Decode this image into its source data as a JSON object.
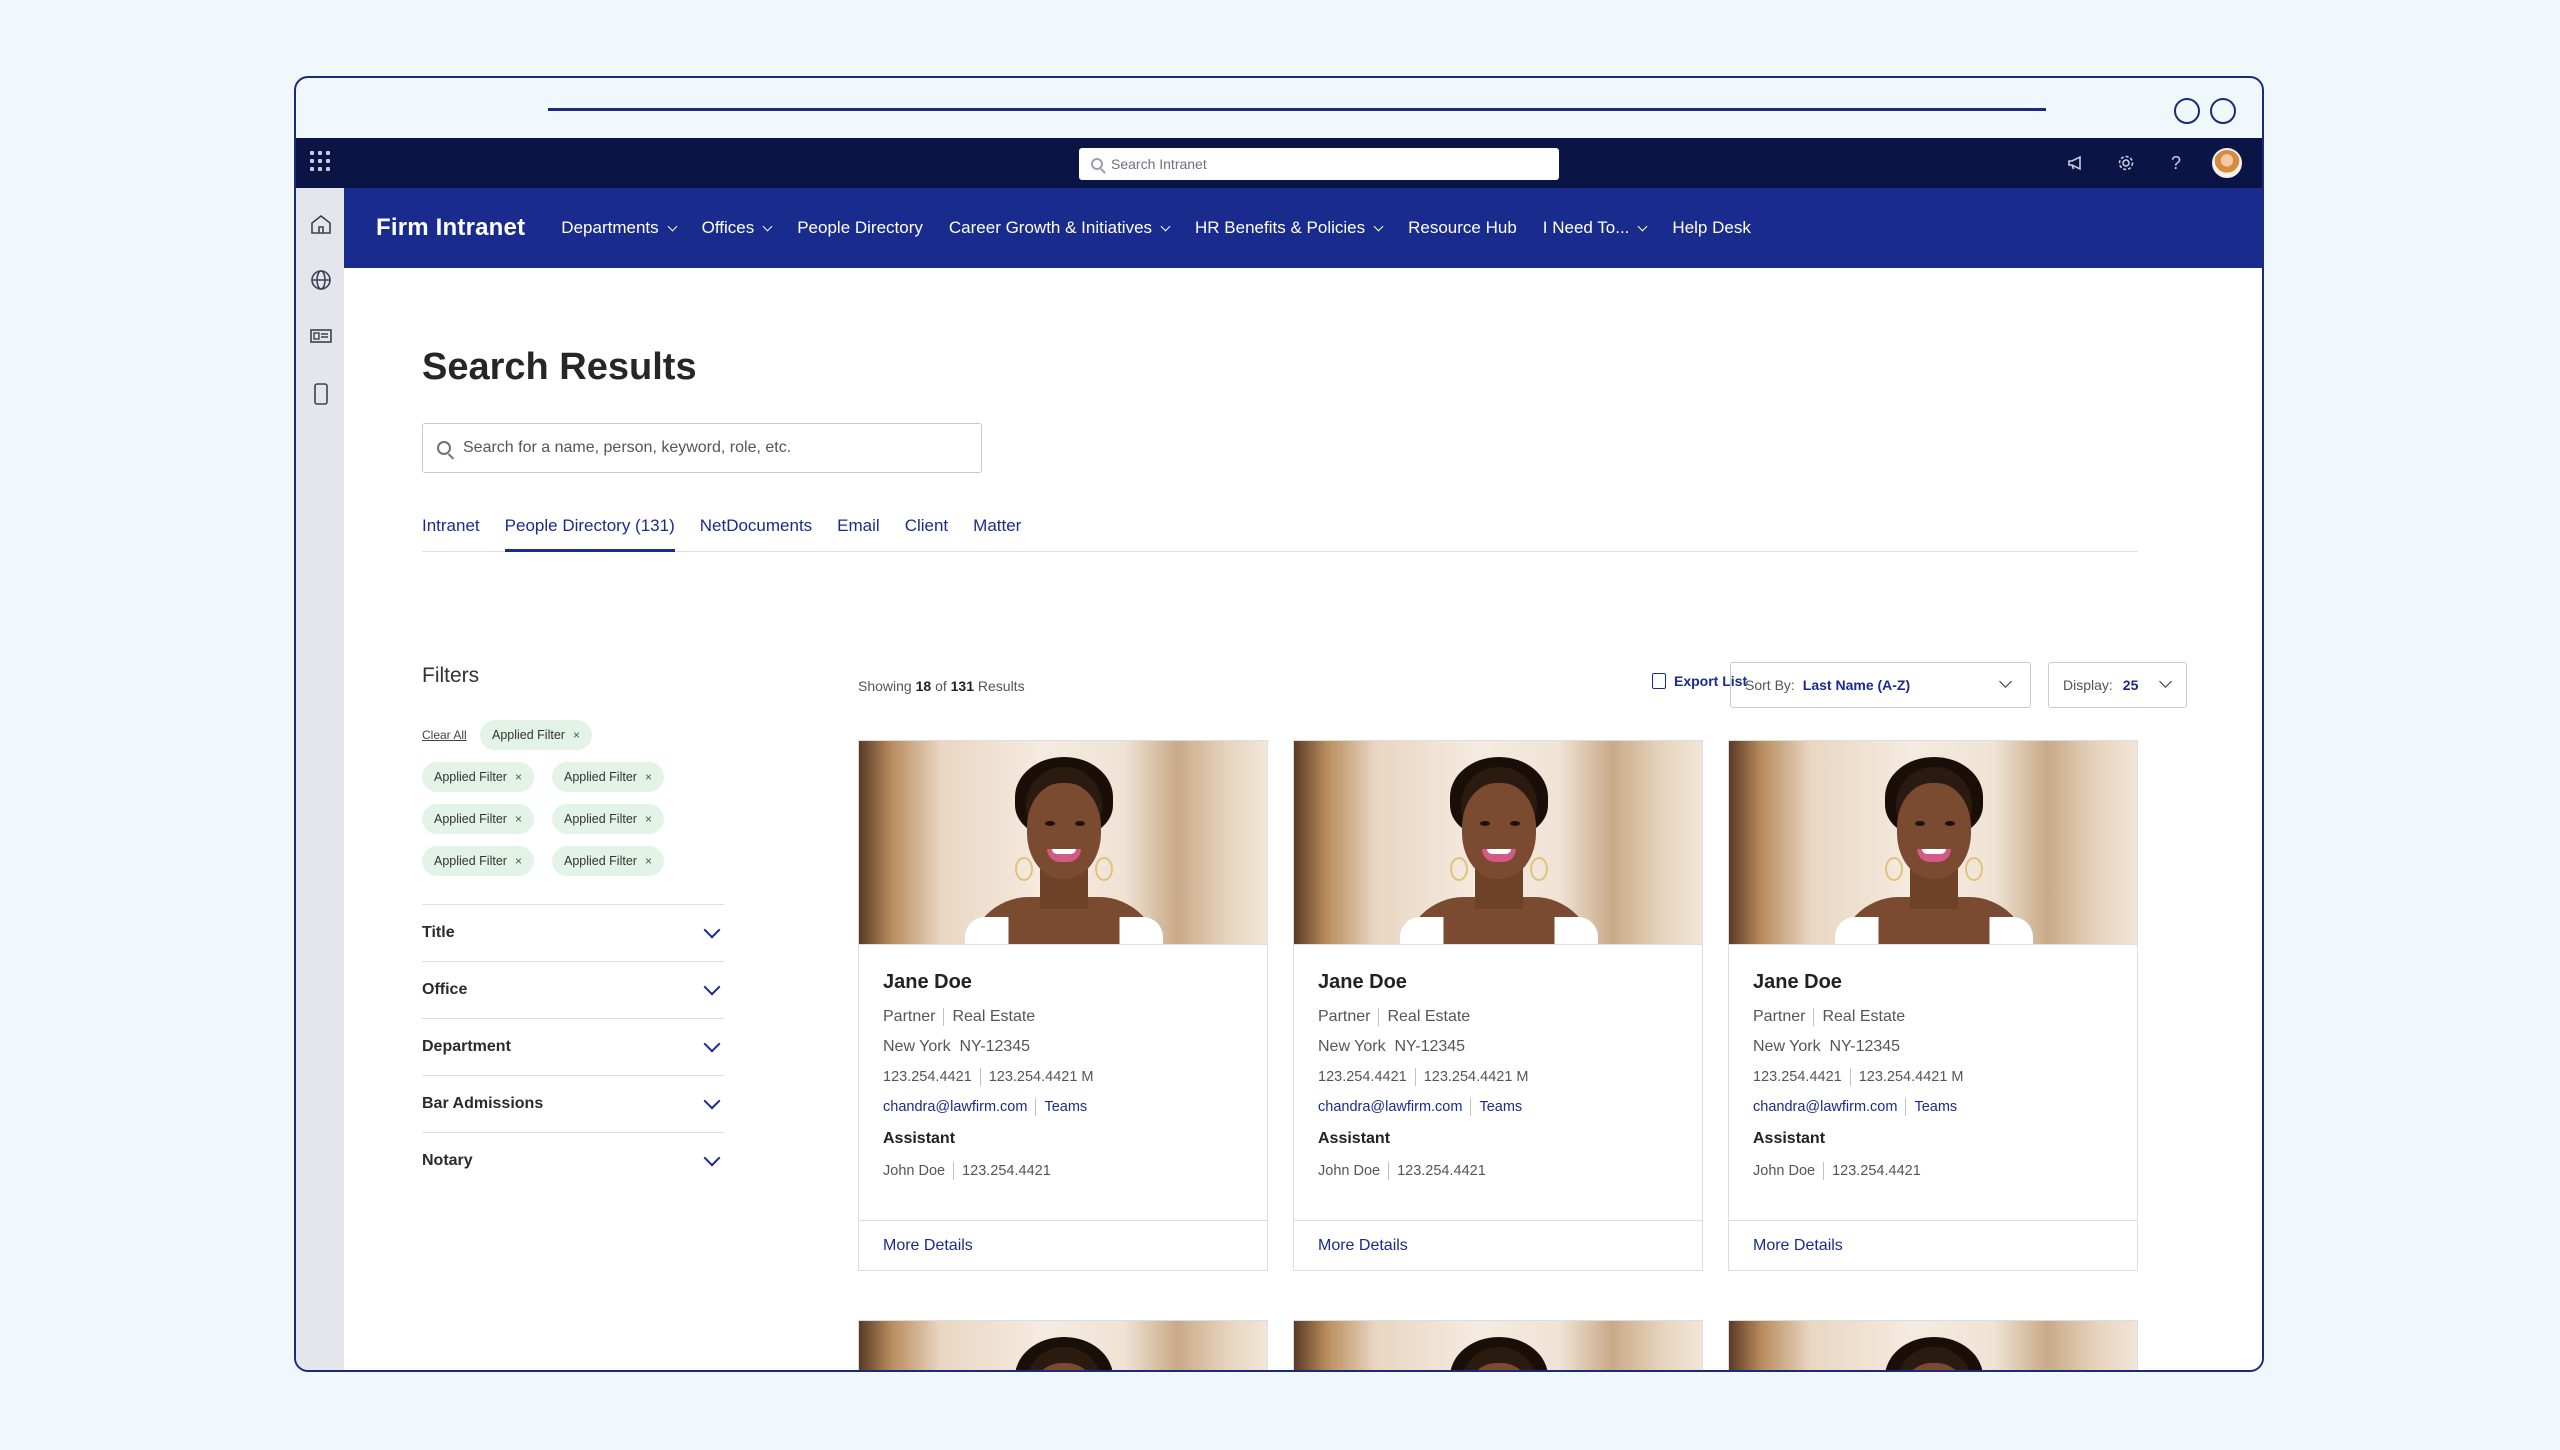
{
  "topbar": {
    "search_placeholder": "Search Intranet",
    "icons": [
      "apps-grid-icon",
      "megaphone-icon",
      "gear-icon",
      "help-icon",
      "avatar"
    ]
  },
  "rail": {
    "icons": [
      "home-icon",
      "globe-icon",
      "news-icon",
      "tablet-icon"
    ]
  },
  "nav": {
    "brand": "Firm Intranet",
    "items": [
      {
        "label": "Departments",
        "dropdown": true
      },
      {
        "label": "Offices",
        "dropdown": true
      },
      {
        "label": "People Directory",
        "dropdown": false
      },
      {
        "label": "Career Growth & Initiatives",
        "dropdown": true
      },
      {
        "label": "HR Benefits & Policies",
        "dropdown": true
      },
      {
        "label": "Resource Hub",
        "dropdown": false
      },
      {
        "label": "I Need To...",
        "dropdown": true
      },
      {
        "label": "Help Desk",
        "dropdown": false
      }
    ]
  },
  "page": {
    "title": "Search Results",
    "search_placeholder": "Search for a name, person, keyword, role, etc."
  },
  "tabs": [
    "Intranet",
    "People Directory (131)",
    "NetDocuments",
    "Email",
    "Client",
    "Matter"
  ],
  "active_tab_index": 1,
  "filters": {
    "title": "Filters",
    "clear_all": "Clear All",
    "chip_label": "Applied Filter",
    "chip_close": "×",
    "sections": [
      "Title",
      "Office",
      "Department",
      "Bar Admissions",
      "Notary"
    ]
  },
  "results": {
    "showing_prefix": "Showing",
    "showing_count": "18",
    "showing_of": "of",
    "showing_total": "131",
    "showing_suffix": "Results",
    "export_label": "Export List",
    "sort_label": "Sort By:",
    "sort_value": "Last Name (A-Z)",
    "display_label": "Display:",
    "display_value": "25"
  },
  "person": {
    "name": "Jane Doe",
    "title": "Partner",
    "practice": "Real Estate",
    "office": "New York",
    "id": "NY-12345",
    "phone": "123.254.4421",
    "mobile": "123.254.4421 M",
    "email": "chandra@lawfirm.com",
    "teams": "Teams",
    "assistant_label": "Assistant",
    "assistant_name": "John Doe",
    "assistant_phone": "123.254.4421",
    "more_details": "More Details"
  },
  "colors": {
    "brand_navy": "#1a2b8e",
    "topbar": "#0a1546",
    "chip_bg": "#e3f3e8"
  }
}
